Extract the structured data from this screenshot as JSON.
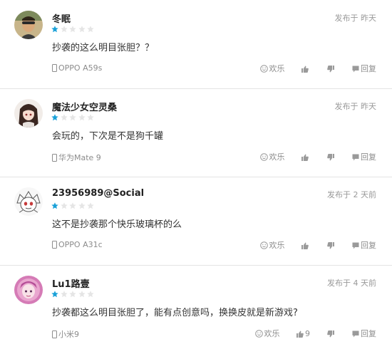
{
  "colors": {
    "star_filled": "#1aa1d8",
    "star_empty": "#e5e5e5",
    "divider": "#e4e4e4",
    "meta_text": "#999999"
  },
  "reviews": [
    {
      "username": "冬眠",
      "time_prefix": "发布于",
      "time": "昨天",
      "rating": 1,
      "max_rating": 5,
      "comment": "抄袭的这么明目张胆？？",
      "device": "OPPO A59s",
      "fun_label": "欢乐",
      "like_count": "",
      "reply_label": "回复"
    },
    {
      "username": "魔法少女空灵桑",
      "time_prefix": "发布于",
      "time": "昨天",
      "rating": 1,
      "max_rating": 5,
      "comment": "会玩的，下次是不是狗千罐",
      "device": "华为Mate 9",
      "fun_label": "欢乐",
      "like_count": "",
      "reply_label": "回复"
    },
    {
      "username": "23956989@Social",
      "time_prefix": "发布于",
      "time": "2 天前",
      "rating": 1,
      "max_rating": 5,
      "comment": "这不是抄袭那个快乐玻璃杯的么",
      "device": "OPPO A31c",
      "fun_label": "欢乐",
      "like_count": "",
      "reply_label": "回复"
    },
    {
      "username": "Lu1路壹",
      "time_prefix": "发布于",
      "time": "4 天前",
      "rating": 1,
      "max_rating": 5,
      "comment": "抄袭都这么明目张胆了，能有点创意吗，换换皮就是新游戏?",
      "device": "小米9",
      "fun_label": "欢乐",
      "like_count": "9",
      "reply_label": "回复"
    }
  ]
}
